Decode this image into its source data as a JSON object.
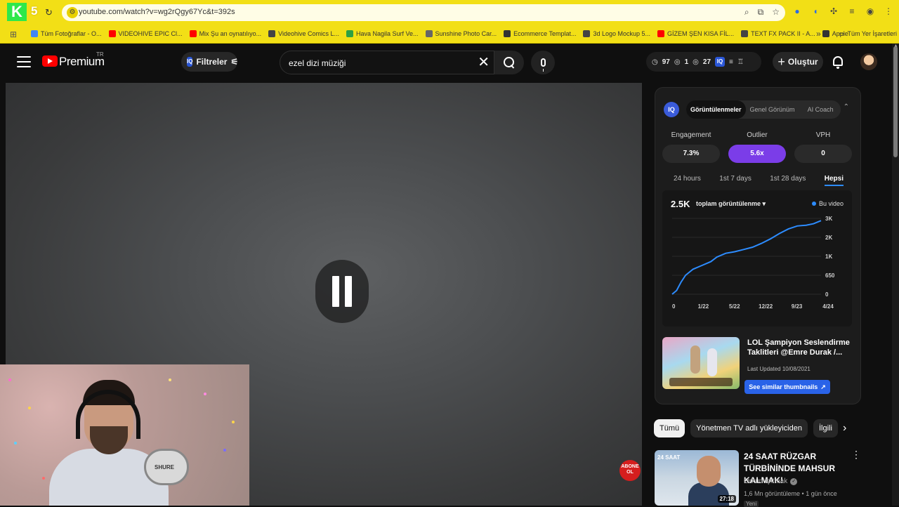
{
  "browser": {
    "url": "youtube.com/watch?v=wg2rQgy67Yc&t=392s",
    "bookmarks": [
      {
        "label": "Tüm Fotoğraflar - O...",
        "color": "#4285f4"
      },
      {
        "label": "VIDEOHIVE EPIC Cl...",
        "color": "#ff0000"
      },
      {
        "label": "Mix Şu an oynatılıyo...",
        "color": "#ff0000"
      },
      {
        "label": "Videohive Comics L...",
        "color": "#444444"
      },
      {
        "label": "Hava Nagila Surf Ve...",
        "color": "#2ea043"
      },
      {
        "label": "Sunshine Photo Car...",
        "color": "#666666"
      },
      {
        "label": "Ecommerce Templat...",
        "color": "#333333"
      },
      {
        "label": "3d Logo Mockup 5...",
        "color": "#444444"
      },
      {
        "label": "GİZEM ŞEN KISA FİL...",
        "color": "#ff0000"
      },
      {
        "label": "TEXT FX PACK II - A...",
        "color": "#444444"
      },
      {
        "label": "Apple",
        "color": "#333333"
      }
    ],
    "all_bookmarks": "Tüm Yer İşaretleri"
  },
  "header": {
    "logo": "Premium",
    "region": "TR",
    "filter_label": "Filtreler",
    "search_value": "ezel dizi müziği",
    "stats": {
      "views": "97",
      "a": "1",
      "b": "27"
    },
    "create_label": "Oluştur"
  },
  "iq_panel": {
    "logo": "IQ",
    "tabs": [
      "Görüntülenmeler",
      "Genel Görünüm",
      "AI Coach"
    ],
    "metrics": [
      {
        "label": "Engagement",
        "value": "7.3%"
      },
      {
        "label": "Outlier",
        "value": "5.6x"
      },
      {
        "label": "VPH",
        "value": "0"
      }
    ],
    "ranges": [
      "24 hours",
      "1st 7 days",
      "1st 28 days",
      "Hepsi"
    ],
    "total": "2.5K",
    "metric_select": "toplam görüntülenme",
    "legend": "Bu video",
    "suggested": {
      "title": "LOL Şampiyon Seslendirme Taklitleri @Emre Durak /...",
      "meta": "Last Updated 10/08/2021",
      "button": "See similar thumbnails"
    }
  },
  "chart_data": {
    "type": "line",
    "title": "",
    "xlabel": "",
    "ylabel": "",
    "x": [
      "0",
      "1/22",
      "5/22",
      "12/22",
      "9/23",
      "4/24"
    ],
    "y_ticks": [
      "0",
      "650",
      "1K",
      "2K",
      "3K"
    ],
    "series": [
      {
        "name": "Bu video",
        "color": "#2d8cff",
        "points": [
          [
            0,
            0
          ],
          [
            0.03,
            0.05
          ],
          [
            0.06,
            0.16
          ],
          [
            0.09,
            0.25
          ],
          [
            0.14,
            0.33
          ],
          [
            0.2,
            0.38
          ],
          [
            0.26,
            0.43
          ],
          [
            0.3,
            0.49
          ],
          [
            0.36,
            0.54
          ],
          [
            0.42,
            0.56
          ],
          [
            0.48,
            0.59
          ],
          [
            0.54,
            0.62
          ],
          [
            0.6,
            0.67
          ],
          [
            0.66,
            0.73
          ],
          [
            0.72,
            0.8
          ],
          [
            0.78,
            0.86
          ],
          [
            0.84,
            0.9
          ],
          [
            0.9,
            0.91
          ],
          [
            0.95,
            0.93
          ],
          [
            1.0,
            0.97
          ]
        ]
      }
    ],
    "legend": "top-right"
  },
  "chips": {
    "items": [
      "Tümü",
      "Yönetmen TV adlı yükleyiciden",
      "İlgili"
    ]
  },
  "recommendation": {
    "tag": "24 SAAT",
    "title": "24 SAAT RÜZGAR TÜRBİNİNDE MAHSUR KALMAK!",
    "channel": "Orkun Işıtmak",
    "meta": "1,6 Mn görüntüleme • 1 gün önce",
    "duration": "27:18",
    "badge": "Yeni"
  },
  "player": {
    "subscribe_badge": "ABONE OL",
    "mic_brand": "SHURE"
  }
}
